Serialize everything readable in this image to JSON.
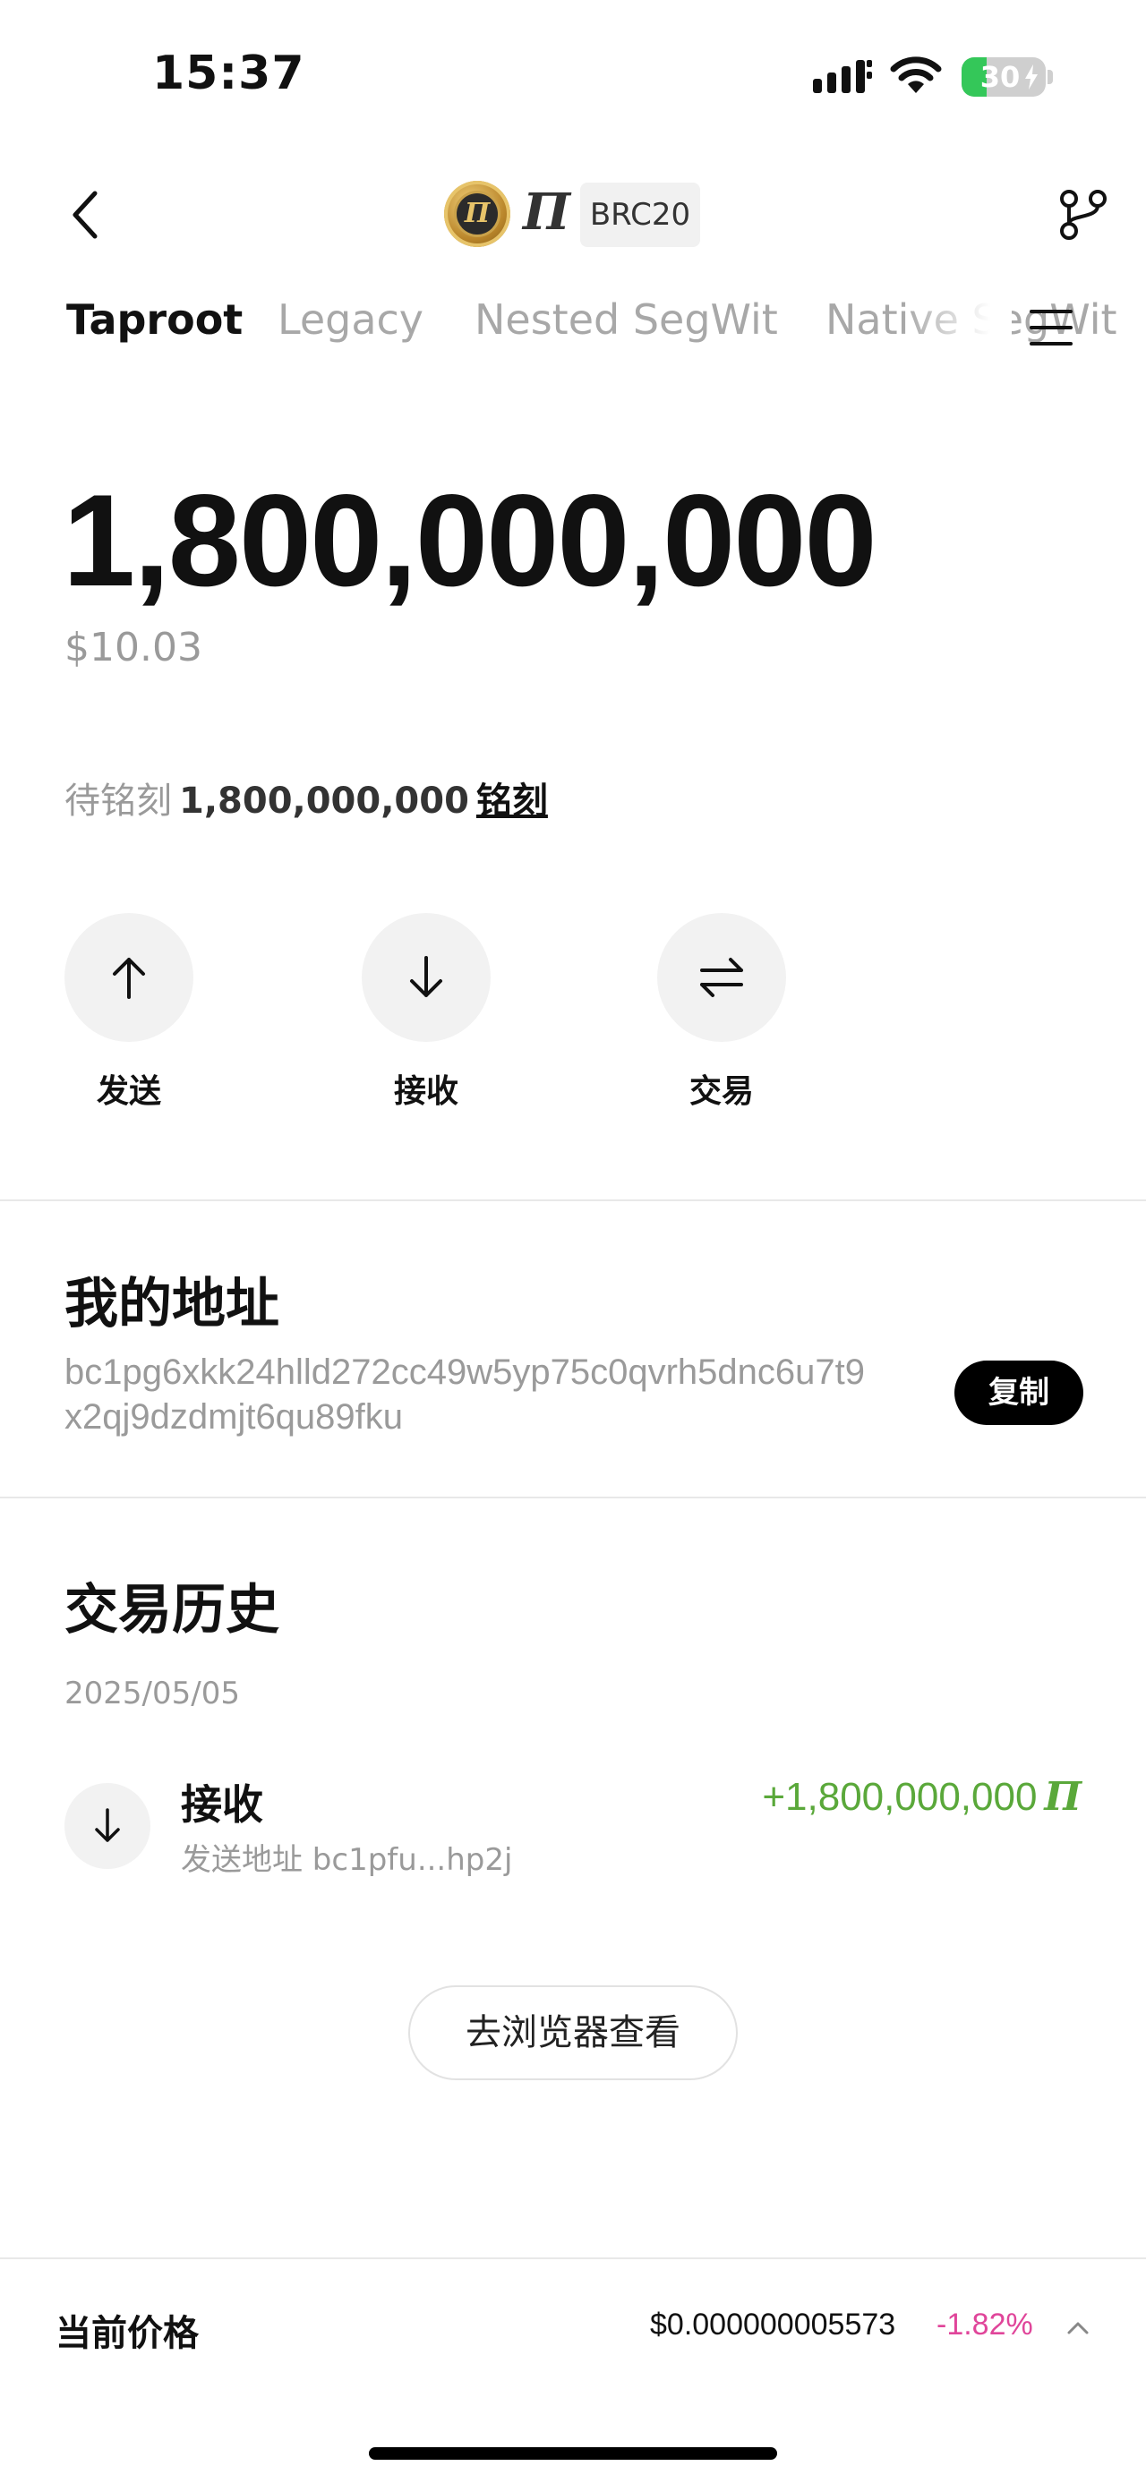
{
  "status_bar": {
    "time": "15:37",
    "battery_level": "30",
    "battery_fraction": 0.3,
    "battery_color": "#34c759",
    "icons": [
      "signal-icon",
      "wifi-icon",
      "battery-icon"
    ]
  },
  "nav": {
    "token_symbol": "Π",
    "token_standard": "BRC20",
    "icons": [
      "back-icon",
      "token-logo",
      "branch-icon"
    ]
  },
  "tabs": [
    {
      "label": "Taproot",
      "active": true
    },
    {
      "label": "Legacy",
      "active": false
    },
    {
      "label": "Nested SegWit",
      "active": false
    },
    {
      "label": "Native SegWit",
      "active": false
    }
  ],
  "balance": {
    "amount": "1,800,000,000",
    "usd_value": "$10.03"
  },
  "pending": {
    "label": "待铭刻",
    "value": "1,800,000,000",
    "action": "铭刻"
  },
  "actions": [
    {
      "label": "发送",
      "icon": "arrow-up-icon"
    },
    {
      "label": "接收",
      "icon": "arrow-down-icon"
    },
    {
      "label": "交易",
      "icon": "swap-icon"
    }
  ],
  "address_section": {
    "title": "我的地址",
    "address": "bc1pg6xkk24hlld272cc49w5yp75c0qvrh5dnc6u7t9x2qj9dzdmjt6qu89fku",
    "copy_label": "复制"
  },
  "history": {
    "title": "交易历史",
    "date": "2025/05/05",
    "transactions": [
      {
        "type": "接收",
        "from_label": "发送地址 bc1pfu...hp2j",
        "amount": "+1,800,000,000",
        "symbol": "Π",
        "amount_color": "#5aa83a"
      }
    ],
    "explorer_label": "去浏览器查看"
  },
  "price_bar": {
    "label": "当前价格",
    "price": "$0.000000005573",
    "change": "-1.82%",
    "change_color": "#e0459a"
  }
}
